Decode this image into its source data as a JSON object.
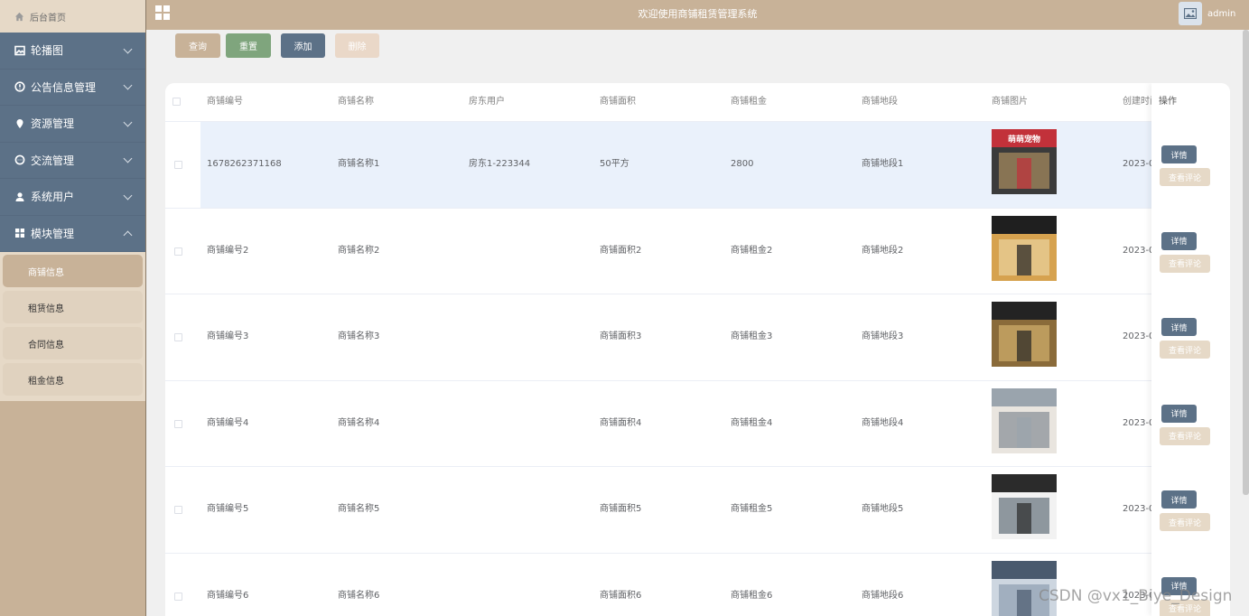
{
  "header": {
    "title": "欢迎使用商铺租赁管理系统",
    "username": "admin"
  },
  "sidebar": {
    "home_label": "后台首页",
    "menu": [
      {
        "label": "轮播图",
        "icon": "image-icon",
        "expanded": false
      },
      {
        "label": "公告信息管理",
        "icon": "info-circle-icon",
        "expanded": false
      },
      {
        "label": "资源管理",
        "icon": "location-pin-icon",
        "expanded": false
      },
      {
        "label": "交流管理",
        "icon": "chat-icon",
        "expanded": false
      },
      {
        "label": "系统用户",
        "icon": "user-icon",
        "expanded": false
      },
      {
        "label": "模块管理",
        "icon": "grid-icon",
        "expanded": true
      }
    ],
    "submenu": [
      {
        "label": "商铺信息",
        "active": true
      },
      {
        "label": "租赁信息",
        "active": false
      },
      {
        "label": "合同信息",
        "active": false
      },
      {
        "label": "租金信息",
        "active": false
      }
    ]
  },
  "toolbar": {
    "query": "查询",
    "reset": "重置",
    "add": "添加",
    "delete": "删除"
  },
  "table": {
    "columns": [
      "商铺编号",
      "商铺名称",
      "房东用户",
      "商铺面积",
      "商铺租金",
      "商铺地段",
      "商铺图片",
      "创建时间",
      "操作"
    ],
    "rows": [
      {
        "code": "1678262371168",
        "name": "商铺名称1",
        "landlord": "房东1-223344",
        "area": "50平方",
        "rent": "2800",
        "location": "商铺地段1",
        "created": "2023-0",
        "thumb_text": "萌萌宠物",
        "highlighted": true
      },
      {
        "code": "商铺编号2",
        "name": "商铺名称2",
        "landlord": "",
        "area": "商铺面积2",
        "rent": "商铺租金2",
        "location": "商铺地段2",
        "created": "2023-0",
        "thumb_text": "",
        "highlighted": false
      },
      {
        "code": "商铺编号3",
        "name": "商铺名称3",
        "landlord": "",
        "area": "商铺面积3",
        "rent": "商铺租金3",
        "location": "商铺地段3",
        "created": "2023-0",
        "thumb_text": "",
        "highlighted": false
      },
      {
        "code": "商铺编号4",
        "name": "商铺名称4",
        "landlord": "",
        "area": "商铺面积4",
        "rent": "商铺租金4",
        "location": "商铺地段4",
        "created": "2023-0",
        "thumb_text": "",
        "highlighted": false
      },
      {
        "code": "商铺编号5",
        "name": "商铺名称5",
        "landlord": "",
        "area": "商铺面积5",
        "rent": "商铺租金5",
        "location": "商铺地段5",
        "created": "2023-0",
        "thumb_text": "",
        "highlighted": false
      },
      {
        "code": "商铺编号6",
        "name": "商铺名称6",
        "landlord": "",
        "area": "商铺面积6",
        "rent": "商铺租金6",
        "location": "商铺地段6",
        "created": "2023-0",
        "thumb_text": "",
        "highlighted": false
      }
    ],
    "actions": {
      "detail": "详情",
      "review": "查看评论"
    }
  },
  "watermark": "CSDN @vx1_Biye_Design",
  "colors": {
    "sidebar_bg": "#c8b298",
    "menu_bg": "#5c7187",
    "header_bg": "#c8b298",
    "reset_green": "#7fa57d",
    "highlight_row": "#eaf1fb"
  }
}
